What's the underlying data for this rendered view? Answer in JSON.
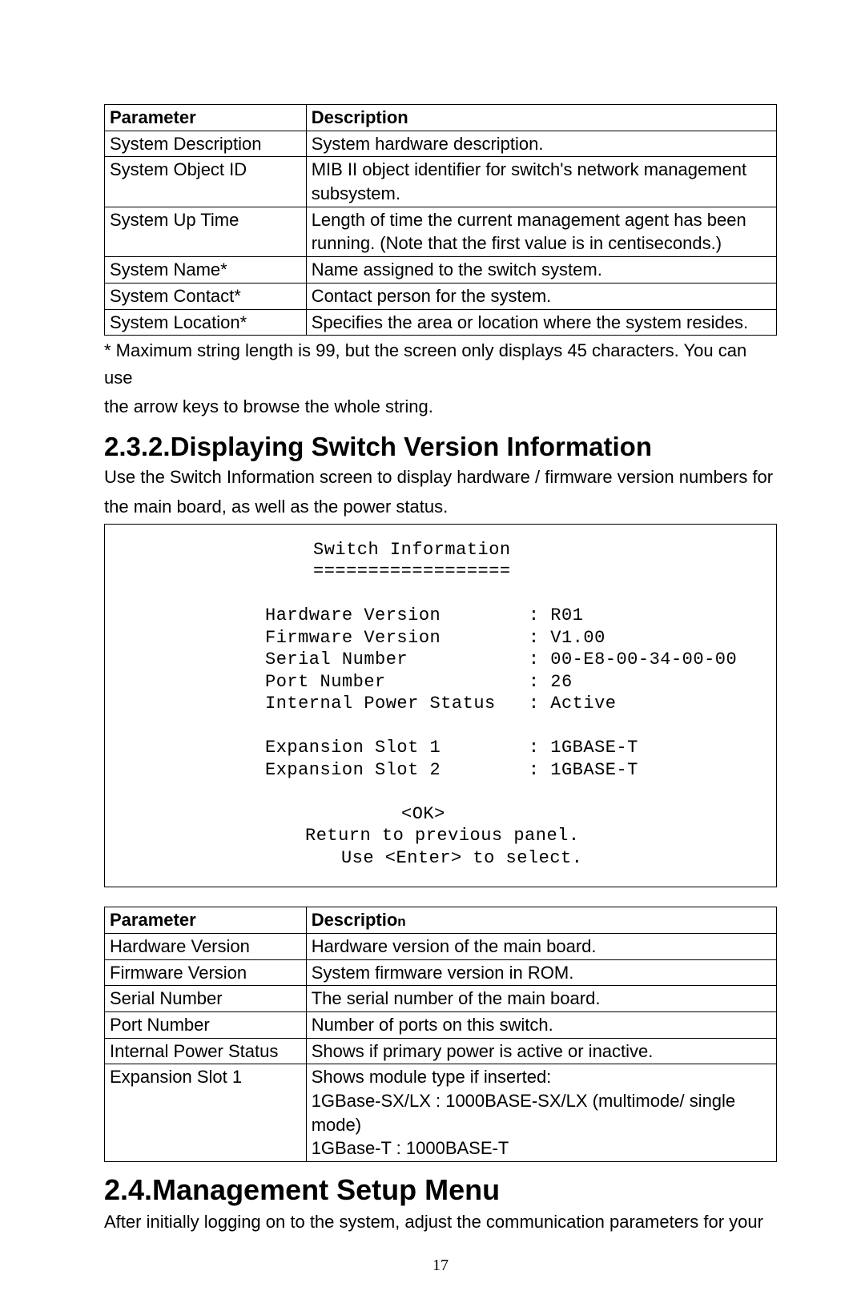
{
  "table1": {
    "header": {
      "param": "Parameter",
      "desc": "Description"
    },
    "rows": [
      {
        "param": "System Description",
        "desc": "System hardware description."
      },
      {
        "param": "System Object ID",
        "desc": "MIB II object identifier for switch's network management subsystem."
      },
      {
        "param": "System Up Time",
        "desc": "Length of time the current management agent has been running. (Note that the first value is in centiseconds.)"
      },
      {
        "param": "System Name*",
        "desc": "Name assigned to the switch system."
      },
      {
        "param": "System Contact*",
        "desc": "Contact person for the system."
      },
      {
        "param": "System Location*",
        "desc": "Specifies the area or location where the system resides."
      }
    ]
  },
  "note1_line1": "* Maximum string length is 99, but the screen only displays 45 characters. You can use",
  "note1_line2": "the arrow keys to browse the whole string.",
  "section1_title": "2.3.2.Displaying Switch Version Information",
  "section1_p1": "Use the Switch Information screen to display hardware / firmware version numbers for",
  "section1_p2": "the main board, as well as the power status.",
  "console": {
    "title": "Switch Information",
    "under": "==================",
    "l1": "Hardware Version        : R01",
    "l2": "Firmware Version        : V1.00",
    "l3": "Serial Number           : 00-E8-00-34-00-00",
    "l4": "Port Number             : 26",
    "l5": "Internal Power Status   : Active",
    "l6": "Expansion Slot 1        : 1GBASE-T",
    "l7": "Expansion Slot 2        : 1GBASE-T",
    "ok": "<OK>",
    "ret": "Return to previous panel.",
    "use": "Use <Enter> to select."
  },
  "table2": {
    "header": {
      "param": "Parameter",
      "desc_main": "Descriptio",
      "desc_tail": "n"
    },
    "rows": [
      {
        "param": "Hardware Version",
        "desc": "Hardware version of the main board."
      },
      {
        "param": "Firmware Version",
        "desc": "System firmware version in ROM."
      },
      {
        "param": "Serial Number",
        "desc": "The serial number of the main board."
      },
      {
        "param": "Port Number",
        "desc": "Number of ports on this switch."
      },
      {
        "param": "Internal Power Status",
        "desc": "Shows if primary power is active or inactive."
      },
      {
        "param": "Expansion Slot 1",
        "desc": "Shows module type if inserted:\n1GBase-SX/LX  : 1000BASE-SX/LX (multimode/ single mode)\n1GBase-T          : 1000BASE-T"
      }
    ]
  },
  "section2_title": "2.4.Management Setup Menu",
  "section2_p1": "After initially logging on to the system, adjust the communication parameters for your",
  "pagenum": "17"
}
